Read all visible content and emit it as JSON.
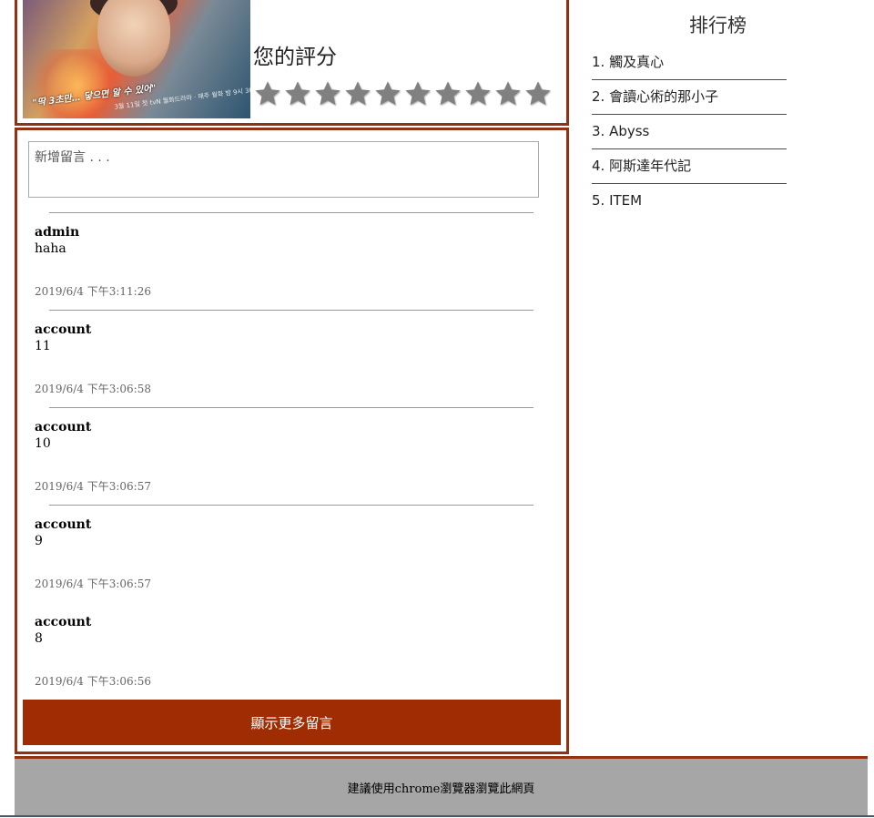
{
  "movie": {
    "poster_caption": "\"딱 3초만… 닿으면 알 수 있어\"",
    "poster_smallprint": "3월 11일 첫 tvN 월화드라마 · 매주 월화 밤 9시 30분",
    "rating_label": "您的評分",
    "stars_total": 10,
    "stars_selected": 0,
    "star_color": "#808080"
  },
  "comments": {
    "input_placeholder": "新增留言 . . .",
    "items": [
      {
        "author": "admin",
        "text": "haha",
        "time": "2019/6/4 下午3:11:26"
      },
      {
        "author": "account",
        "text": "11",
        "time": "2019/6/4 下午3:06:58"
      },
      {
        "author": "account",
        "text": "10",
        "time": "2019/6/4 下午3:06:57"
      },
      {
        "author": "account",
        "text": "9",
        "time": "2019/6/4 下午3:06:57"
      },
      {
        "author": "account",
        "text": "8",
        "time": "2019/6/4 下午3:06:56"
      }
    ],
    "more_label": "顯示更多留言"
  },
  "ranking": {
    "title": "排行榜",
    "items": [
      "1. 觸及真心",
      "2. 會讀心術的那小子",
      "3. Abyss",
      "4. 阿斯達年代記",
      "5. ITEM"
    ]
  },
  "footer": {
    "text": "建議使用chrome瀏覽器瀏覽此網頁"
  },
  "colors": {
    "accent": "#923214",
    "button": "#a02c04",
    "footer_bg": "#a6a6a6"
  }
}
